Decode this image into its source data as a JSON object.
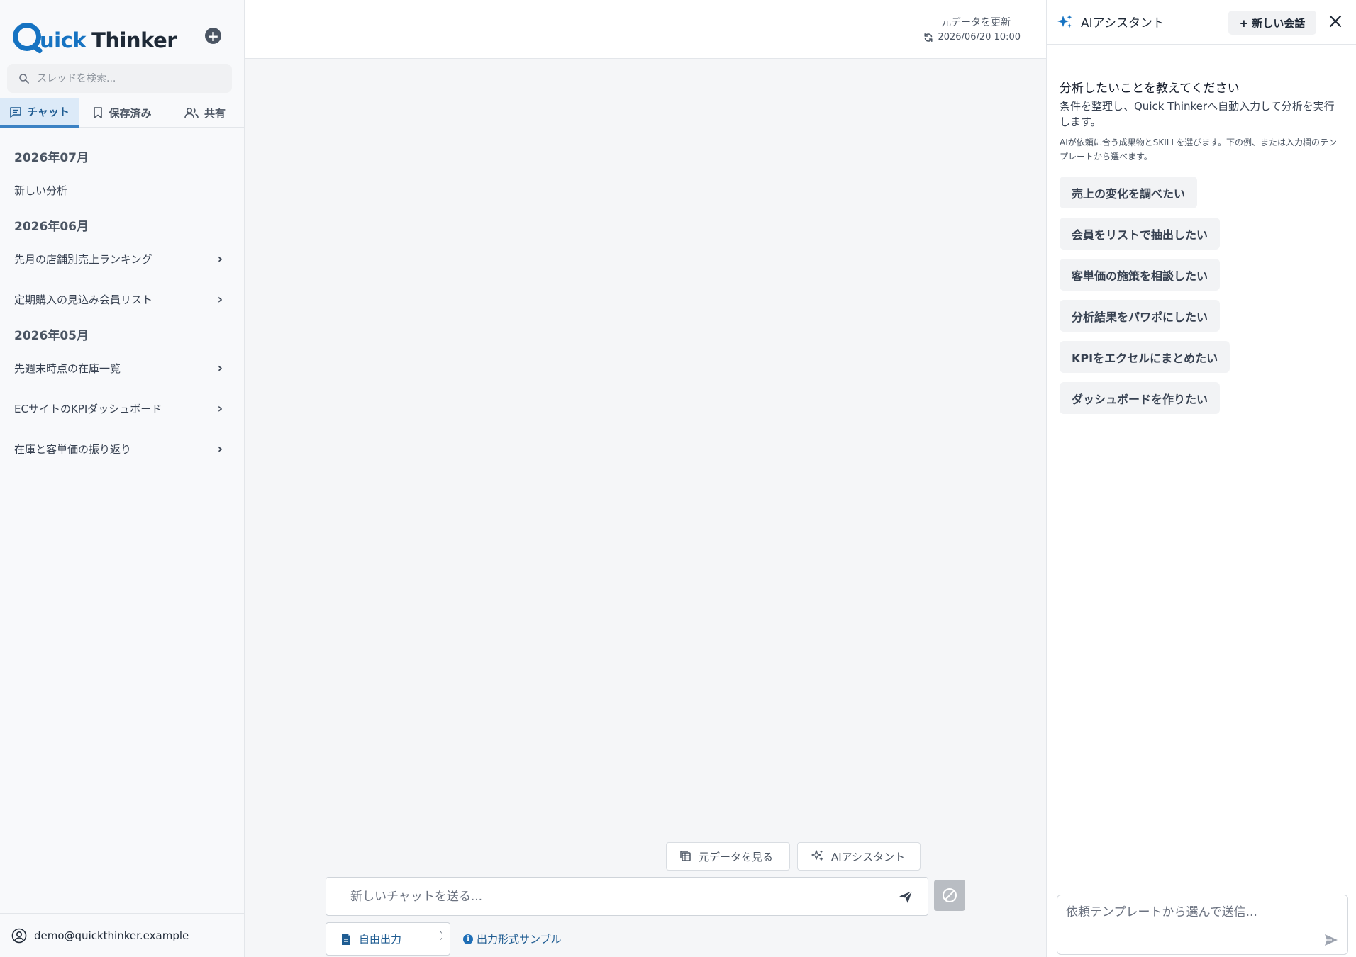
{
  "brand": {
    "logo_part1": "uick",
    "logo_part2": "Thinker",
    "logo_letter": "Q"
  },
  "sidebar": {
    "search_placeholder": "スレッドを検索...",
    "tabs": [
      {
        "label": "チャット",
        "icon": "chat-icon",
        "active": true
      },
      {
        "label": "保存済み",
        "icon": "bookmark-icon",
        "active": false
      },
      {
        "label": "共有",
        "icon": "users-icon",
        "active": false
      }
    ],
    "groups": [
      {
        "month": "2026年07月",
        "threads": [
          {
            "title": "新しい分析",
            "chevron": false
          }
        ]
      },
      {
        "month": "2026年06月",
        "threads": [
          {
            "title": "先月の店舗別売上ランキング",
            "chevron": true
          },
          {
            "title": "定期購入の見込み会員リスト",
            "chevron": true
          }
        ]
      },
      {
        "month": "2026年05月",
        "threads": [
          {
            "title": "先週末時点の在庫一覧",
            "chevron": true
          },
          {
            "title": "ECサイトのKPIダッシュボード",
            "chevron": true
          },
          {
            "title": "在庫と客単価の振り返り",
            "chevron": true
          }
        ]
      }
    ],
    "user_email": "demo@quickthinker.example"
  },
  "main": {
    "refresh_label": "元データを更新",
    "refresh_time": "2026/06/20 10:00",
    "view_data_label": "元データを見る",
    "ai_assistant_label": "AIアシスタント",
    "chat_placeholder": "新しいチャットを送る...",
    "output_format_value": "自由出力",
    "sample_link_label": "出力形式サンプル"
  },
  "panel": {
    "title": "AIアシスタント",
    "new_conversation_label": "+ 新しい会話",
    "heading": "分析したいことを教えてください",
    "description": "条件を整理し、Quick Thinkerへ自動入力して分析を実行します。",
    "note": "AIが依頼に合う成果物とSKILLを選びます。下の例、または入力欄のテンプレートから選べます。",
    "suggestions": [
      "売上の変化を調べたい",
      "会員をリストで抽出したい",
      "客単価の施策を相談したい",
      "分析結果をパワポにしたい",
      "KPIをエクセルにまとめたい",
      "ダッシュボードを作りたい"
    ],
    "input_placeholder": "依頼テンプレートから選んで送信..."
  },
  "colors": {
    "brand_blue": "#1673c2",
    "tab_active_bg": "#dceaf8",
    "link": "#1f5c92"
  }
}
